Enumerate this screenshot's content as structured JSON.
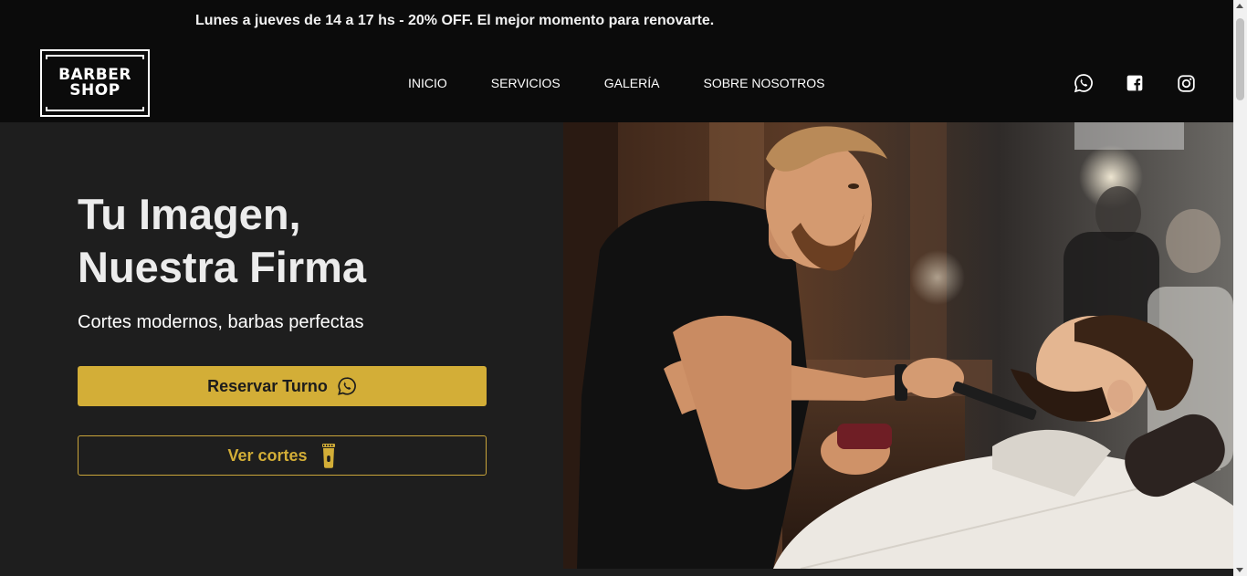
{
  "promo": {
    "text": "Lunes a jueves de 14 a 17 hs - 20% OFF. El mejor momento para renovarte."
  },
  "logo": {
    "line1": "BARBER",
    "line2": "SHOP"
  },
  "nav": {
    "items": [
      {
        "label": "INICIO"
      },
      {
        "label": "SERVICIOS"
      },
      {
        "label": "GALERÍA"
      },
      {
        "label": "SOBRE NOSOTROS"
      }
    ]
  },
  "social": {
    "icons": [
      "whatsapp-icon",
      "facebook-icon",
      "instagram-icon"
    ]
  },
  "hero": {
    "title_line1": "Tu Imagen,",
    "title_line2": "Nuestra Firma",
    "subtitle": "Cortes modernos, barbas perfectas",
    "primary_button": "Reservar Turno",
    "secondary_button": "Ver cortes"
  },
  "colors": {
    "accent": "#d3ae37",
    "nav_background": "#0b0b0b",
    "hero_background": "#1e1e1e"
  }
}
